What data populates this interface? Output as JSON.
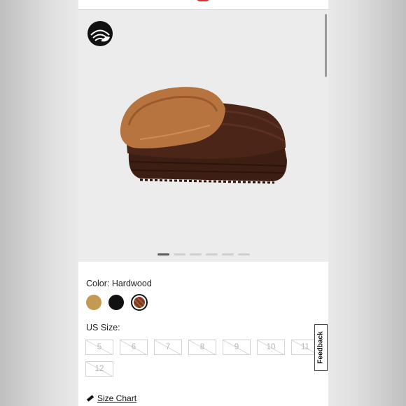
{
  "product": {
    "color_label": "Color: Hardwood",
    "swatches": [
      {
        "name": "Chestnut",
        "color": "#c49a52",
        "selected": false
      },
      {
        "name": "Black",
        "color": "#111111",
        "selected": false
      },
      {
        "name": "Hardwood",
        "color": "#7a3a22",
        "selected": true
      }
    ],
    "size_label": "US Size:",
    "sizes": [
      {
        "label": "5",
        "available": false
      },
      {
        "label": "6",
        "available": false
      },
      {
        "label": "7",
        "available": false
      },
      {
        "label": "8",
        "available": false
      },
      {
        "label": "9",
        "available": false
      },
      {
        "label": "10",
        "available": false
      },
      {
        "label": "11",
        "available": false
      },
      {
        "label": "12",
        "available": false
      }
    ],
    "size_chart_label": "Size Chart"
  },
  "gallery": {
    "image_count": 6,
    "active_index": 0
  },
  "feedback_label": "Feedback",
  "colors": {
    "accent": "#d9362b",
    "shoe_body": "#4a2518",
    "shoe_fur": "#b8743f"
  }
}
